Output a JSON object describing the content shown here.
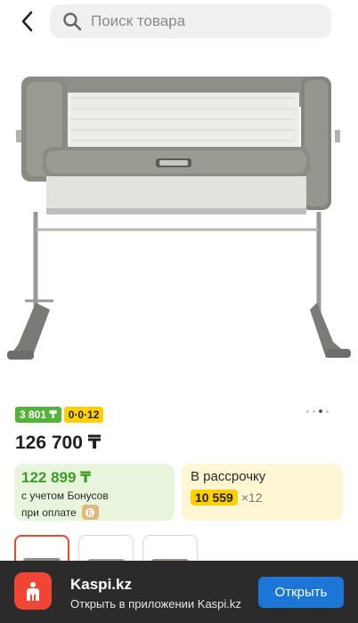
{
  "search": {
    "placeholder": "Поиск товара"
  },
  "badges": {
    "bonus": "3 801 ₸",
    "installment": "0·0·12"
  },
  "price": "126 700 ₸",
  "bonus_card": {
    "price": "122 899 ₸",
    "line1": "с учетом Бонусов",
    "line2": "при оплате"
  },
  "installment_card": {
    "title": "В рассрочку",
    "amount": "10 559",
    "term": "×12"
  },
  "gallery": {
    "total_images": 4,
    "active_index": 3
  },
  "app_banner": {
    "name": "Kaspi.kz",
    "description": "Открыть в приложении Kaspi.kz",
    "button": "Открыть"
  },
  "colors": {
    "kaspi_red": "#f14635",
    "bonus_green": "#53b23a",
    "yellow": "#ffd000",
    "banner_bg": "#2b2b2b",
    "button_blue": "#1b76d6"
  },
  "icons": [
    "back-arrow-icon",
    "search-icon",
    "kaspi-logo-icon",
    "bonus-icon"
  ]
}
